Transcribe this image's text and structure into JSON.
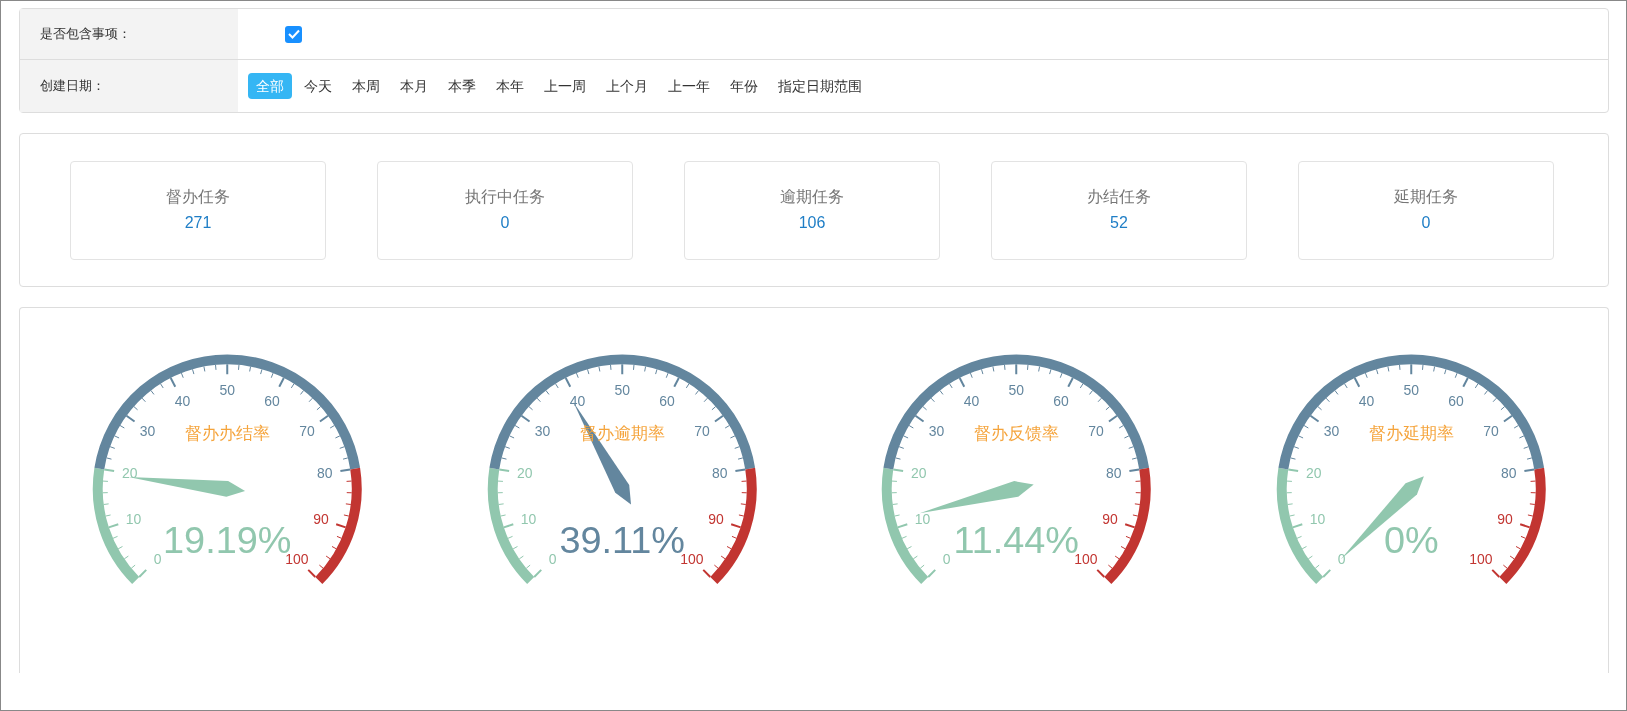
{
  "filters": {
    "include_items": {
      "label": "是否包含事项：",
      "checked": true
    },
    "created_date": {
      "label": "创建日期：",
      "options": [
        {
          "label": "全部",
          "selected": true
        },
        {
          "label": "今天",
          "selected": false
        },
        {
          "label": "本周",
          "selected": false
        },
        {
          "label": "本月",
          "selected": false
        },
        {
          "label": "本季",
          "selected": false
        },
        {
          "label": "本年",
          "selected": false
        },
        {
          "label": "上一周",
          "selected": false
        },
        {
          "label": "上个月",
          "selected": false
        },
        {
          "label": "上一年",
          "selected": false
        },
        {
          "label": "年份",
          "selected": false
        },
        {
          "label": "指定日期范围",
          "selected": false
        }
      ]
    }
  },
  "stats": [
    {
      "label": "督办任务",
      "value": "271"
    },
    {
      "label": "执行中任务",
      "value": "0"
    },
    {
      "label": "逾期任务",
      "value": "106"
    },
    {
      "label": "办结任务",
      "value": "52"
    },
    {
      "label": "延期任务",
      "value": "0"
    }
  ],
  "gauges": [
    {
      "title": "督办办结率",
      "reading": "19.19%",
      "scale_labels": [
        "0",
        "10",
        "20",
        "30",
        "40",
        "50",
        "60",
        "70",
        "80",
        "90",
        "100"
      ]
    },
    {
      "title": "督办逾期率",
      "reading": "39.11%",
      "scale_labels": [
        "0",
        "10",
        "20",
        "30",
        "40",
        "50",
        "60",
        "70",
        "80",
        "90",
        "100"
      ]
    },
    {
      "title": "督办反馈率",
      "reading": "11.44%",
      "scale_labels": [
        "0",
        "10",
        "20",
        "30",
        "40",
        "50",
        "60",
        "70",
        "80",
        "90",
        "100"
      ]
    },
    {
      "title": "督办延期率",
      "reading": "0%",
      "scale_labels": [
        "0",
        "10",
        "20",
        "30",
        "40",
        "50",
        "60",
        "70",
        "80",
        "90",
        "100"
      ]
    }
  ]
}
